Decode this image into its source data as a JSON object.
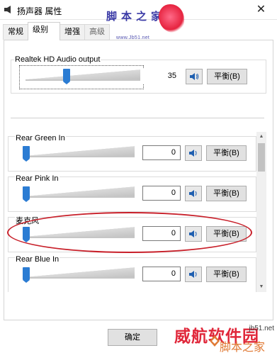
{
  "window": {
    "title": "扬声器 属性",
    "close_glyph": "✕"
  },
  "watermark_top": {
    "brand": "脚本之家",
    "url": "www.Jb51.net"
  },
  "tabs": [
    {
      "label": "常规",
      "active": false
    },
    {
      "label": "级别",
      "active": true
    },
    {
      "label": "增强",
      "active": false
    },
    {
      "label": "高级",
      "active": false
    }
  ],
  "master": {
    "label": "Realtek HD Audio output",
    "value": "35",
    "level_percent": 35,
    "balance_label": "平衡(B)",
    "mute_icon": "speaker-icon"
  },
  "inputs": [
    {
      "label": "Rear Green In",
      "value": "0",
      "level_percent": 0,
      "balance_label": "平衡(B)"
    },
    {
      "label": "Rear Pink In",
      "value": "0",
      "level_percent": 0,
      "balance_label": "平衡(B)"
    },
    {
      "label": "麦克风",
      "value": "0",
      "level_percent": 0,
      "balance_label": "平衡(B)"
    },
    {
      "label": "Rear Blue In",
      "value": "0",
      "level_percent": 0,
      "balance_label": "平衡(B)"
    }
  ],
  "buttons": {
    "ok_label": "确定"
  },
  "watermark_bottom": {
    "text": "威航软件园",
    "site": "jb51.net",
    "sub": "脚本之家"
  },
  "colors": {
    "slider_thumb": "#2b7cd3",
    "highlight": "#c8202a",
    "watermark_red": "#e0273a"
  }
}
